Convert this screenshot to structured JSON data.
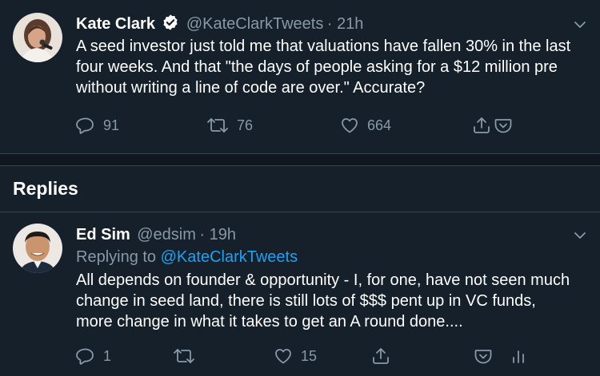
{
  "tweet": {
    "name": "Kate Clark",
    "handle": "@KateClarkTweets",
    "time": "· 21h",
    "text_lines": [
      "A seed investor just told me that valuations have fallen 30% in the last",
      "four weeks. And that \"the days of people asking for a $12 million pre",
      "without writing a line of code are over.\" Accurate?"
    ],
    "replies_count": "91",
    "retweets_count": "76",
    "likes_count": "664"
  },
  "section": {
    "replies_title": "Replies"
  },
  "reply": {
    "name": "Ed Sim",
    "handle": "@edsim",
    "time": "· 19h",
    "replying_prefix": "Replying to",
    "replying_to": "@KateClarkTweets",
    "text_lines": [
      "All depends on founder & opportunity - I, for one, have not seen much",
      "change in seed land, there is still lots of $$$ pent up in VC funds,",
      "more change in what it takes to get an A round done...."
    ],
    "replies_count": "1",
    "likes_count": "15"
  },
  "colors": {
    "background": "#15202b",
    "secondary_text": "#8899a6",
    "link": "#1da1f2",
    "divider": "#38444d"
  }
}
